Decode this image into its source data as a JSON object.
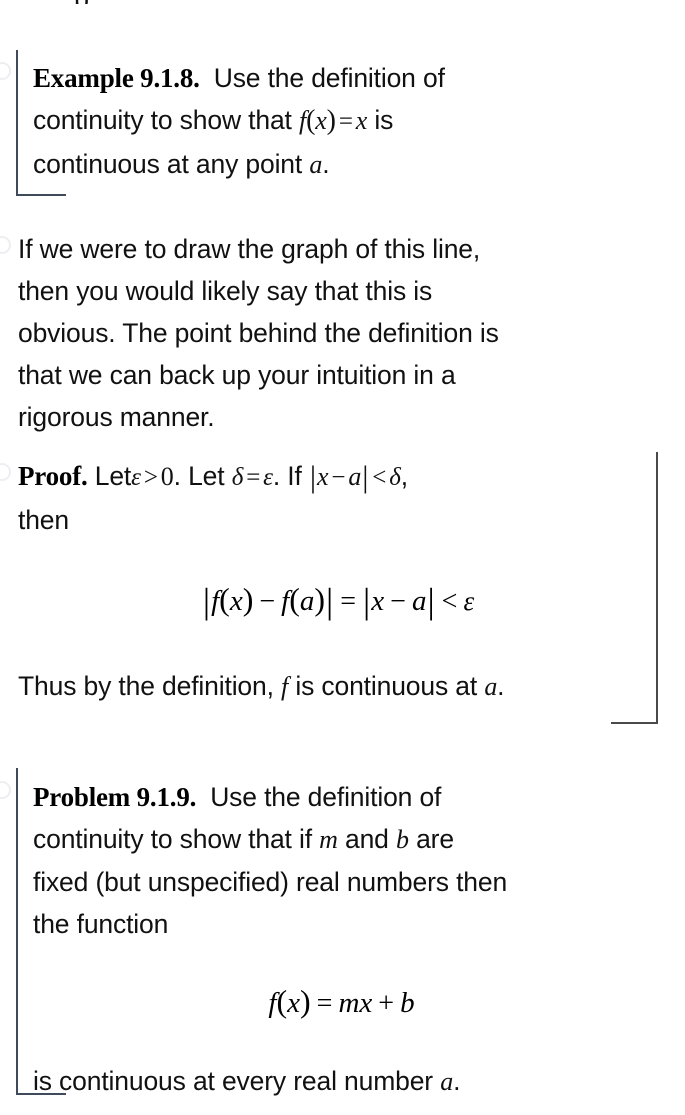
{
  "document": {
    "clipped_top_fragment": "p",
    "body_text_color": "#111111",
    "rule_color": "#3f4a5a",
    "proof_rule_color": "#4a4a4a"
  },
  "example_block": {
    "label": "Example 9.1.8.",
    "line1_tail": "Use the definition of",
    "line2_pre": "continuity to show that",
    "line2_math": "f(x) = x",
    "line2_post": "is",
    "line3_pre": "continuous at any point",
    "line3_math": "a",
    "line3_post": ".",
    "math_tokens": {
      "f": "f",
      "lparen": "(",
      "x": "x",
      "rparen": ")",
      "equals": "=",
      "x2": "x",
      "a": "a"
    }
  },
  "intuition_paragraph": {
    "line1": "If we were to draw the graph of this line,",
    "line2": "then you would likely say that this is",
    "line3": "obvious. The point behind the definition is",
    "line4": "that we can back up your intuition in a",
    "line5": "rigorous manner."
  },
  "proof_block": {
    "label": "Proof.",
    "intro_1": "Let",
    "epsilon": "ε",
    "gt": ">",
    "zero": "0",
    "intro_2": ". Let",
    "delta": "δ",
    "eq": "=",
    "epsilon_2": "ε",
    "intro_3": ". If",
    "abs_open": "|",
    "x": "x",
    "minus": "−",
    "a": "a",
    "abs_close": "|",
    "lt": "<",
    "delta_2": "δ",
    "intro_4": ",",
    "then_word": "then",
    "display_equation": {
      "f": "f",
      "lparen": "(",
      "x": "x",
      "rparen": ")",
      "minus": "−",
      "f2": "f",
      "lparen2": "(",
      "a": "a",
      "rparen2": ")",
      "equals": "=",
      "x2": "x",
      "minus2": "−",
      "a2": "a",
      "lt": "<",
      "epsilon": "ε",
      "bar": "|",
      "plain": "|f(x) − f(a)| = |x − a| < ε"
    },
    "conclusion_pre": "Thus by the definition,",
    "conclusion_math": "f",
    "conclusion_post": "is continuous at",
    "conclusion_math2": "a",
    "conclusion_end": "."
  },
  "problem_block": {
    "label": "Problem 9.1.9.",
    "line1_tail": "Use the definition of",
    "line2_pre": "continuity to show that if",
    "line2_math_m": "m",
    "line2_mid": "and",
    "line2_math_b": "b",
    "line2_post": "are",
    "line3": "fixed (but unspecified) real numbers then",
    "line4": "the function",
    "display_equation": {
      "f": "f",
      "lparen": "(",
      "x": "x",
      "rparen": ")",
      "equals": "=",
      "m": "m",
      "x2": "x",
      "plus": "+",
      "b": "b",
      "plain": "f(x) = mx + b"
    },
    "closing_pre": "is continuous at every real number",
    "closing_math": "a",
    "closing_post": "."
  }
}
